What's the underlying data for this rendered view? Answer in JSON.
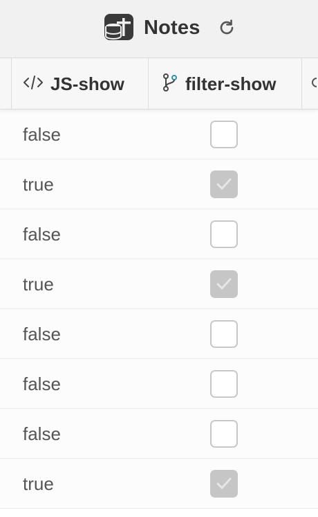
{
  "header": {
    "title": "Notes",
    "icon": "database-plus-icon",
    "refresh_icon": "refresh-icon"
  },
  "columns": [
    {
      "label": "JS-show",
      "icon": "code-icon"
    },
    {
      "label": "filter-show",
      "icon": "git-branch-icon"
    }
  ],
  "rows": [
    {
      "js_show": "false",
      "filter_show": false
    },
    {
      "js_show": "true",
      "filter_show": true
    },
    {
      "js_show": "false",
      "filter_show": false
    },
    {
      "js_show": "true",
      "filter_show": true
    },
    {
      "js_show": "false",
      "filter_show": false
    },
    {
      "js_show": "false",
      "filter_show": false
    },
    {
      "js_show": "false",
      "filter_show": false
    },
    {
      "js_show": "true",
      "filter_show": true
    }
  ],
  "colors": {
    "text": "#333333",
    "cell_text": "#555555",
    "branch_accent": "#2f8fa8",
    "checked_fill": "#c6c6c6"
  }
}
